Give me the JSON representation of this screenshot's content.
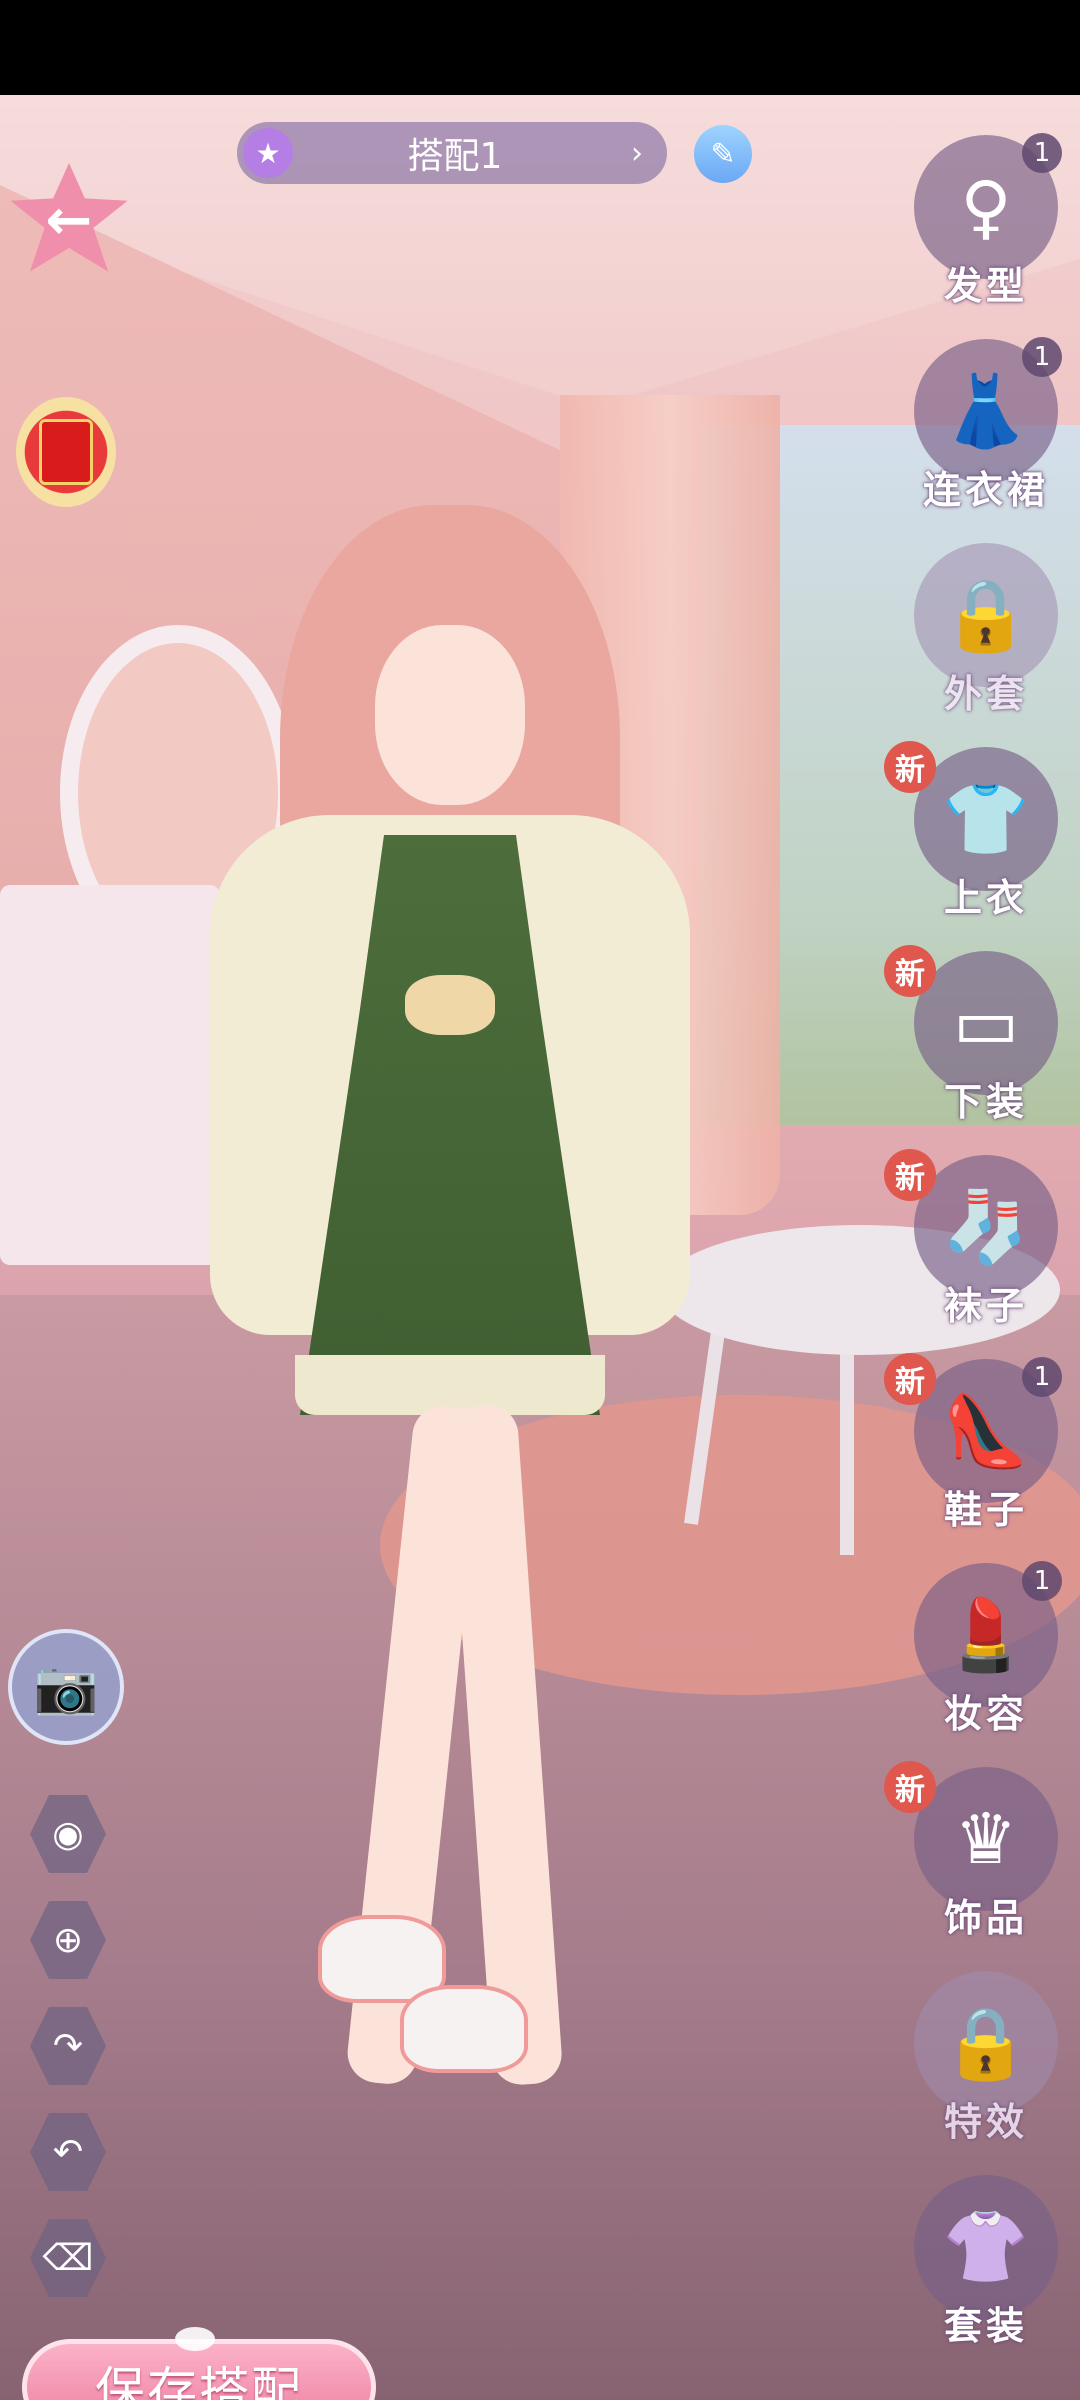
{
  "outfit_bar": {
    "title": "搭配1",
    "star_icon": "star-icon",
    "arrow": "›"
  },
  "edit_icon": "pencil-cube-icon",
  "back_icon": "←",
  "categories": [
    {
      "label": "发型",
      "count": "1",
      "icon": "hair-icon",
      "new": "",
      "locked": false
    },
    {
      "label": "连衣裙",
      "count": "1",
      "icon": "dress-icon",
      "new": "",
      "locked": false
    },
    {
      "label": "外套",
      "count": "",
      "icon": "lock-icon",
      "new": "",
      "locked": true
    },
    {
      "label": "上衣",
      "count": "",
      "icon": "shirt-icon",
      "new": "新",
      "locked": false
    },
    {
      "label": "下装",
      "count": "",
      "icon": "shorts-icon",
      "new": "新",
      "locked": false
    },
    {
      "label": "袜子",
      "count": "",
      "icon": "socks-icon",
      "new": "新",
      "locked": false
    },
    {
      "label": "鞋子",
      "count": "1",
      "icon": "heels-icon",
      "new": "新",
      "locked": false
    },
    {
      "label": "妆容",
      "count": "1",
      "icon": "makeup-icon",
      "new": "",
      "locked": false
    },
    {
      "label": "饰品",
      "count": "",
      "icon": "crown-icon",
      "new": "新",
      "locked": false
    },
    {
      "label": "特效",
      "count": "",
      "icon": "lock-icon",
      "new": "",
      "locked": true
    },
    {
      "label": "套装",
      "count": "",
      "icon": "outfit-set-icon",
      "new": "",
      "locked": false
    }
  ],
  "tools": [
    "eye-icon",
    "target-icon",
    "redo-icon",
    "undo-icon",
    "broom-icon"
  ],
  "save_button": {
    "label": "保存搭配"
  },
  "colors": {
    "accent_pink": "#ef7da0",
    "rail_circle": "#78608a",
    "new_badge": "#e0574e"
  }
}
